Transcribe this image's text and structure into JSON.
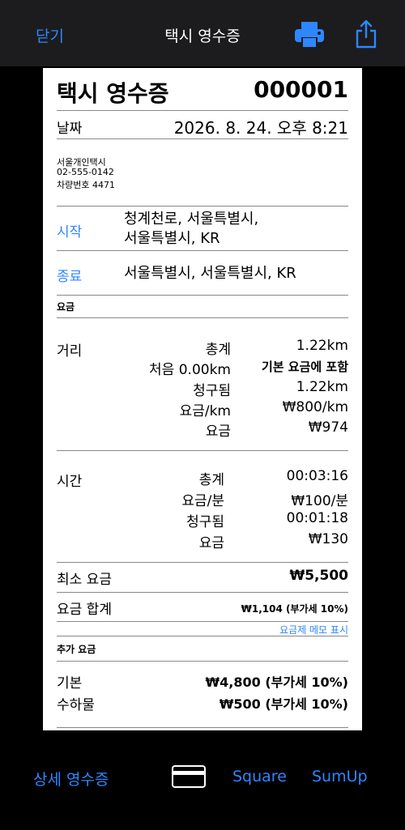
{
  "topbar": {
    "close": "닫기",
    "title": "택시 영수증"
  },
  "receipt": {
    "title": "택시 영수증",
    "number": "000001",
    "date_label": "날짜",
    "date_value": "2026. 8. 24. 오후 8:21",
    "company": {
      "name": "서울개인택시",
      "phone": "02-555-0142",
      "vehicle": "차량번호 4471"
    },
    "start": {
      "label": "시작",
      "address_line1": "청계천로, 서울특별시,",
      "address_line2": "서울특별시, KR"
    },
    "end": {
      "label": "종료",
      "address": "서울특별시, 서울특별시, KR"
    },
    "fare_section": "요금",
    "distance": {
      "label": "거리",
      "rows": [
        {
          "k": "총계",
          "v": "1.22km",
          "bold": false
        },
        {
          "k": "처음 0.00km",
          "v": "기본 요금에 포함",
          "bold": true
        },
        {
          "k": "청구됨",
          "v": "1.22km",
          "bold": false
        },
        {
          "k": "요금/km",
          "v": "₩800/km",
          "bold": false
        },
        {
          "k": "요금",
          "v": "₩974",
          "bold": false
        }
      ]
    },
    "time": {
      "label": "시간",
      "rows": [
        {
          "k": "총계",
          "v": "00:03:16"
        },
        {
          "k": "요금/분",
          "v": "₩100/분"
        },
        {
          "k": "청구됨",
          "v": "00:01:18"
        },
        {
          "k": "요금",
          "v": "₩130"
        }
      ]
    },
    "min_fare": {
      "label": "최소 요금",
      "value": "₩5,500"
    },
    "total": {
      "label": "요금 합계",
      "value": "₩1,104 (부가세 10%)",
      "memo_link": "요금제 메모 표시"
    },
    "extra_section": "추가 요금",
    "extras": [
      {
        "label": "기본",
        "value": "₩4,800 (부가세 10%)"
      },
      {
        "label": "수하물",
        "value": "₩500 (부가세 10%)"
      }
    ]
  },
  "bottombar": {
    "detail": "상세 영수증",
    "square": "Square",
    "sumup": "SumUp"
  },
  "colors": {
    "accent": "#2f86ff",
    "bar": "#1c1c1e"
  },
  "icons": [
    "printer-icon",
    "share-icon",
    "credit-card-icon"
  ]
}
